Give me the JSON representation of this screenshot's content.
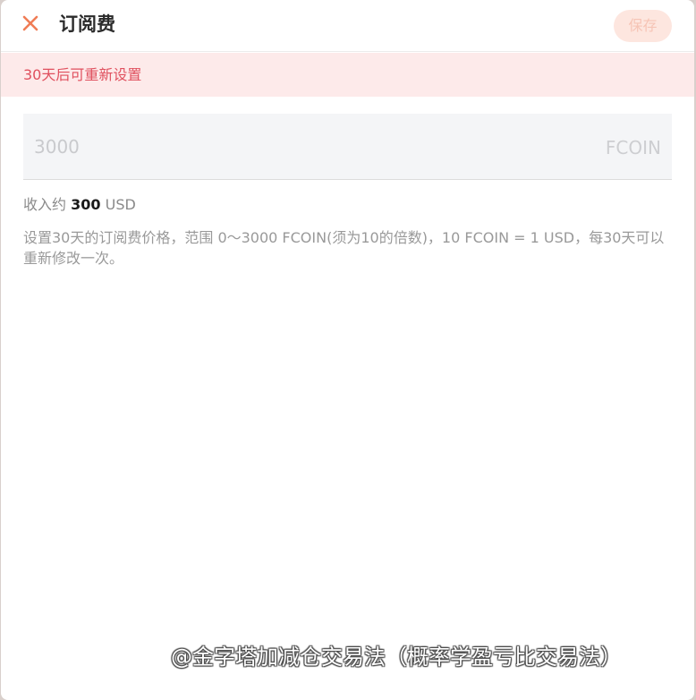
{
  "header": {
    "title": "订阅费",
    "save_label": "保存",
    "close_icon": "close-icon",
    "accent_color": "#f07c55"
  },
  "notice": {
    "text": "30天后可重新设置"
  },
  "price": {
    "value": "3000",
    "unit": "FCOIN"
  },
  "income": {
    "prefix": "收入约",
    "value": "300",
    "currency": "USD"
  },
  "description": "设置30天的订阅费价格，范围 0～3000 FCOIN(须为10的倍数)，10 FCOIN = 1 USD，每30天可以重新修改一次。",
  "watermark": "@金字塔加减仓交易法（概率学盈亏比交易法）"
}
